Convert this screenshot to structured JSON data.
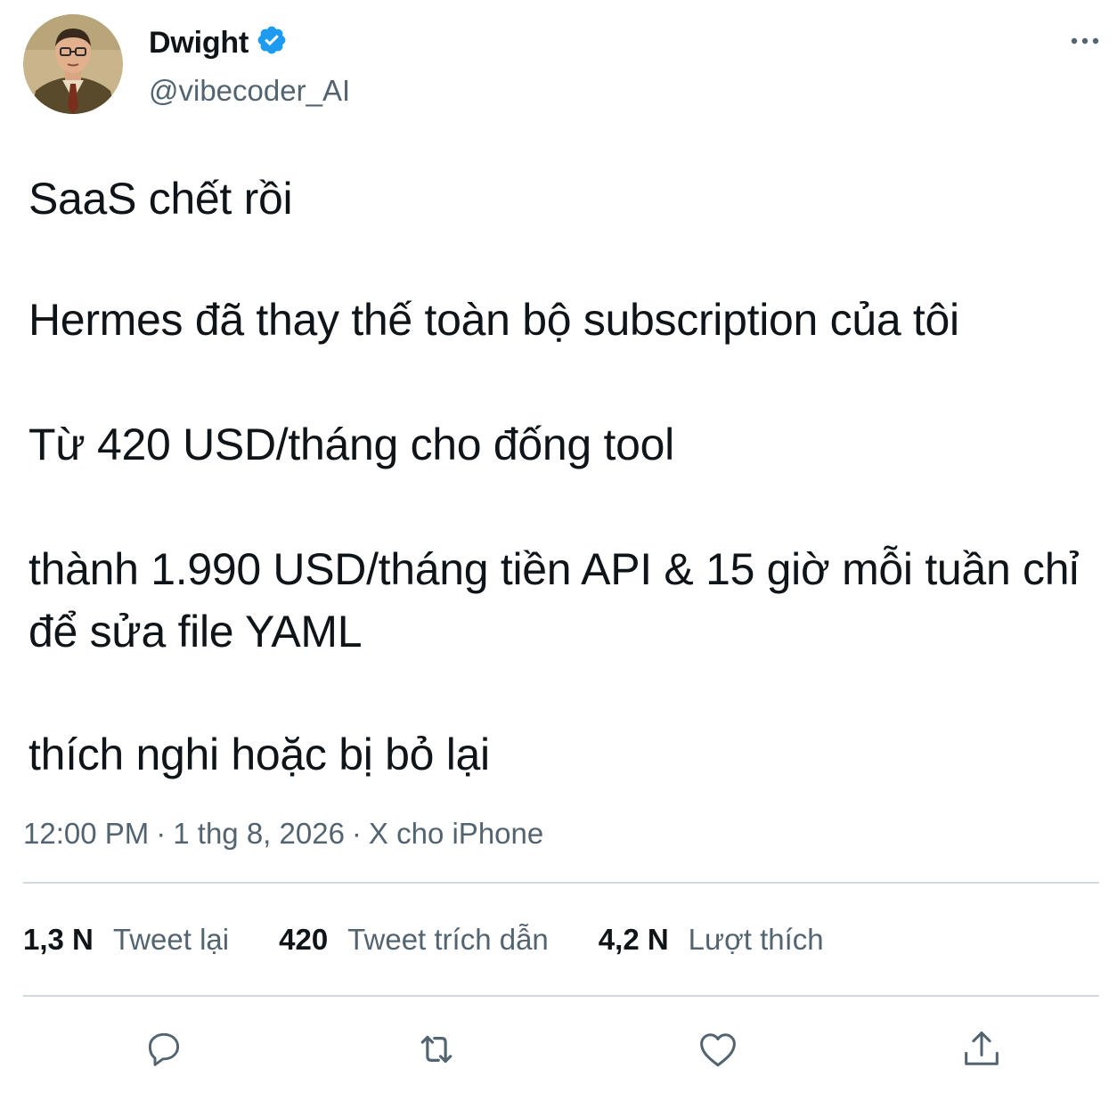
{
  "author": {
    "display_name": "Dwight",
    "handle": "@vibecoder_AI",
    "verified": true,
    "avatar_icon": "profile-photo"
  },
  "tweet": {
    "paragraphs": [
      "SaaS chết rồi",
      "Hermes đã thay thế toàn bộ subscription của tôi",
      "Từ 420 USD/tháng cho đống tool",
      "thành 1.990 USD/tháng tiền API & 15 giờ mỗi tuần chỉ để sửa file YAML",
      "thích nghi hoặc bị bỏ lại"
    ]
  },
  "meta": {
    "time": "12:00 PM",
    "separator": "·",
    "date": "1 thg 8, 2026",
    "source": "X cho iPhone"
  },
  "stats": {
    "retweets": {
      "count": "1,3 N",
      "label": "Tweet lại"
    },
    "quotes": {
      "count": "420",
      "label": "Tweet trích dẫn"
    },
    "likes": {
      "count": "4,2 N",
      "label": "Lượt thích"
    }
  },
  "actions": {
    "reply_icon": "reply-icon",
    "retweet_icon": "retweet-icon",
    "like_icon": "heart-icon",
    "share_icon": "share-icon"
  },
  "colors": {
    "text": "#0f1419",
    "secondary": "#536471",
    "verified": "#1d9bf0",
    "divider": "#cfd9de"
  }
}
